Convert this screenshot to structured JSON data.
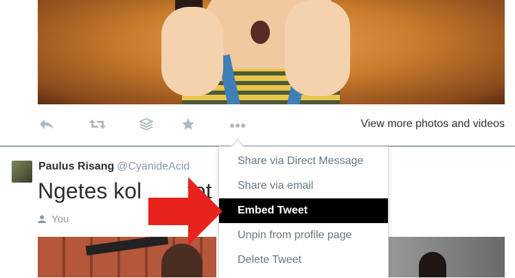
{
  "tweet_actions": {
    "icons": [
      "reply-icon",
      "retweet-icon",
      "stack-icon",
      "favorite-icon",
      "more-icon"
    ],
    "view_more_label": "View more photos and videos"
  },
  "tweet": {
    "fullname": "Paulus Risang",
    "handle": "@CyanideAcid",
    "text": "Ngetes kol",
    "text_tail": "fot",
    "context_label": "You"
  },
  "more_menu": {
    "items": [
      {
        "label": "Share via Direct Message",
        "active": false
      },
      {
        "label": "Share via email",
        "active": false
      },
      {
        "label": "Embed Tweet",
        "active": true
      },
      {
        "label": "Unpin from profile page",
        "active": false
      },
      {
        "label": "Delete Tweet",
        "active": false
      }
    ]
  },
  "colors": {
    "arrow": "#e8231e",
    "active_item_bg": "#000000",
    "icon_gray": "#b0b8bf"
  }
}
